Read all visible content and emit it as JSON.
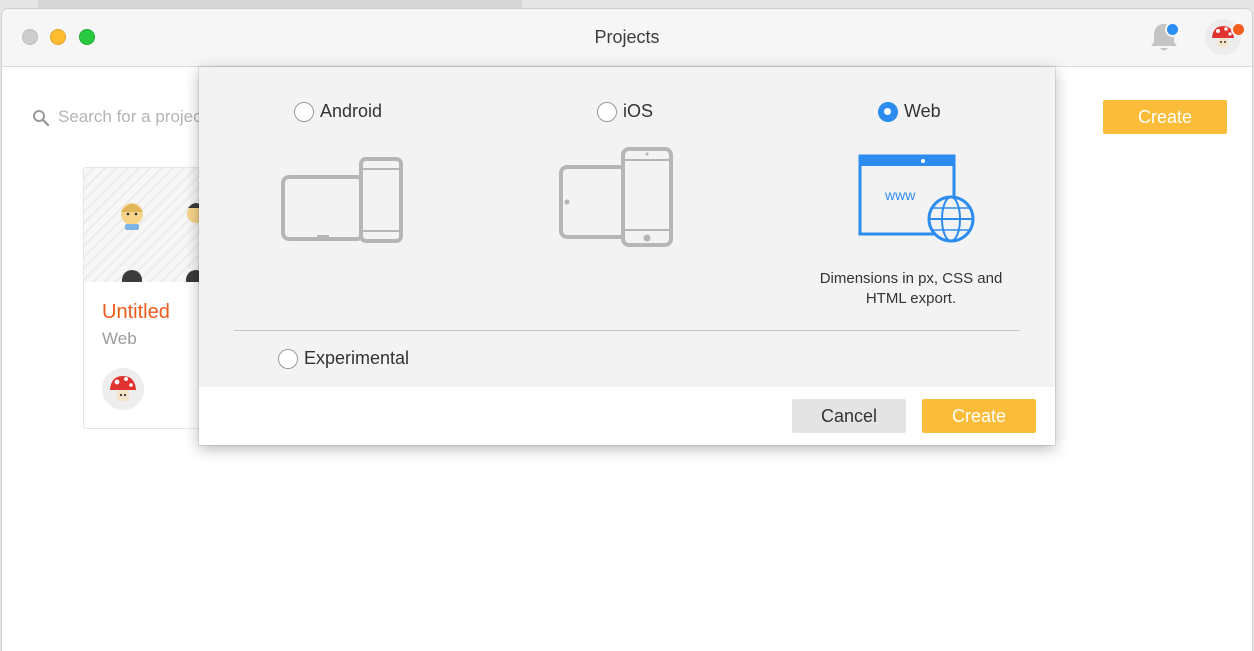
{
  "window": {
    "title": "Projects"
  },
  "header": {
    "bell_icon": "bell-icon",
    "avatar_icon": "mushroom-avatar",
    "bell_badge_color": "#2a8ef5",
    "avatar_badge_color": "#f25c1d"
  },
  "search": {
    "placeholder": "Search for a project"
  },
  "main": {
    "create_label": "Create"
  },
  "project_card": {
    "title": "Untitled",
    "platform": "Web"
  },
  "dialog": {
    "options": [
      {
        "label": "Android",
        "selected": false,
        "icon": "android-devices-icon"
      },
      {
        "label": "iOS",
        "selected": false,
        "icon": "ios-devices-icon"
      },
      {
        "label": "Web",
        "selected": true,
        "icon": "web-browser-globe-icon"
      }
    ],
    "web_description": "Dimensions in px, CSS and HTML export.",
    "experimental": {
      "label": "Experimental",
      "selected": false
    },
    "cancel_label": "Cancel",
    "create_label": "Create"
  },
  "colors": {
    "accent": "#fbbd39",
    "selected": "#2d8cf0",
    "title_orange": "#ef5a1d"
  }
}
